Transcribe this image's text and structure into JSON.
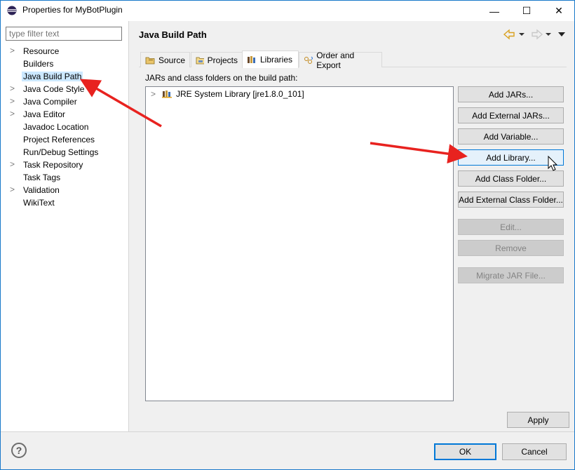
{
  "window": {
    "title": "Properties for MyBotPlugin",
    "minimize_glyph": "—",
    "maximize_glyph": "☐",
    "close_glyph": "✕"
  },
  "filter": {
    "placeholder": "type filter text"
  },
  "tree": [
    {
      "label": "Resource",
      "expandable": true
    },
    {
      "label": "Builders",
      "expandable": false
    },
    {
      "label": "Java Build Path",
      "expandable": false,
      "selected": true
    },
    {
      "label": "Java Code Style",
      "expandable": true
    },
    {
      "label": "Java Compiler",
      "expandable": true
    },
    {
      "label": "Java Editor",
      "expandable": true
    },
    {
      "label": "Javadoc Location",
      "expandable": false
    },
    {
      "label": "Project References",
      "expandable": false
    },
    {
      "label": "Run/Debug Settings",
      "expandable": false
    },
    {
      "label": "Task Repository",
      "expandable": true
    },
    {
      "label": "Task Tags",
      "expandable": false
    },
    {
      "label": "Validation",
      "expandable": true
    },
    {
      "label": "WikiText",
      "expandable": false
    }
  ],
  "page": {
    "title": "Java Build Path"
  },
  "tabs": [
    {
      "label": "Source",
      "icon": "source-folder-icon"
    },
    {
      "label": "Projects",
      "icon": "projects-icon"
    },
    {
      "label": "Libraries",
      "icon": "libraries-icon",
      "active": true
    },
    {
      "label": "Order and Export",
      "icon": "order-export-icon"
    }
  ],
  "libraries": {
    "section_label": "JARs and class folders on the build path:",
    "entries": [
      {
        "label": "JRE System Library [jre1.8.0_101]"
      }
    ]
  },
  "buttons": {
    "add_jars": "Add JARs...",
    "add_external_jars": "Add External JARs...",
    "add_variable": "Add Variable...",
    "add_library": "Add Library...",
    "add_class_folder": "Add Class Folder...",
    "add_external_class_folder": "Add External Class Folder...",
    "edit": "Edit...",
    "remove": "Remove",
    "migrate_jar": "Migrate JAR File..."
  },
  "footer": {
    "apply": "Apply",
    "ok": "OK",
    "cancel": "Cancel",
    "help": "?"
  },
  "colors": {
    "selection": "#cce8ff",
    "accent_border": "#0078d7",
    "annotation_arrow": "#e8221f"
  }
}
